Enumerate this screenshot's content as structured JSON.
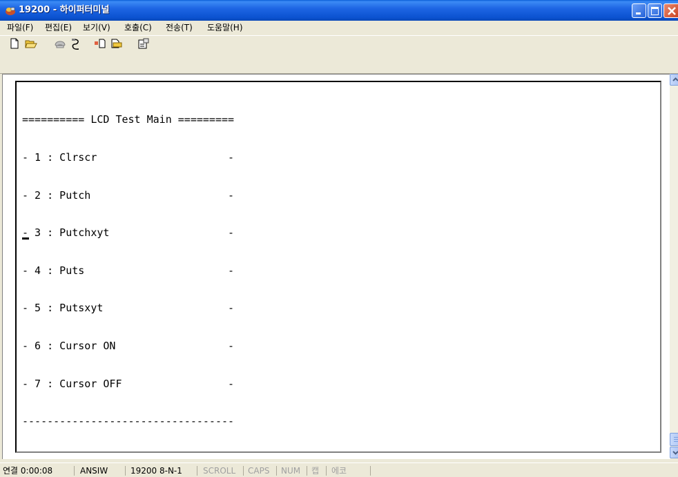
{
  "window": {
    "title": "19200 - 하이퍼터미널"
  },
  "menu": [
    {
      "label": "파일(F)"
    },
    {
      "label": "편집(E)"
    },
    {
      "label": "보기(V)"
    },
    {
      "label": "호출(C)"
    },
    {
      "label": "전송(T)"
    },
    {
      "label": "도움말(H)"
    }
  ],
  "toolbar": {
    "buttons": [
      {
        "icon": "new-document-icon"
      },
      {
        "icon": "open-folder-icon"
      },
      {
        "icon": "phone-icon"
      },
      {
        "icon": "disconnect-icon"
      },
      {
        "icon": "send-file-icon"
      },
      {
        "icon": "receive-file-icon"
      },
      {
        "icon": "properties-icon"
      }
    ]
  },
  "terminal": {
    "lines": [
      "========== LCD Test Main =========",
      "- 1 : Clrscr                     -",
      "- 2 : Putch                      -",
      "- 3 : Putchxyt                   -",
      "- 4 : Puts                       -",
      "- 5 : Putsxyt                    -",
      "- 6 : Cursor ON                  -",
      "- 7 : Cursor OFF                 -",
      "----------------------------------"
    ]
  },
  "status": {
    "connection": "연결 0:00:08",
    "emulation": "ANSIW",
    "port": "19200 8-N-1",
    "scroll": "SCROLL",
    "caps": "CAPS",
    "num": "NUM",
    "capture": "캡",
    "echo": "에코"
  }
}
